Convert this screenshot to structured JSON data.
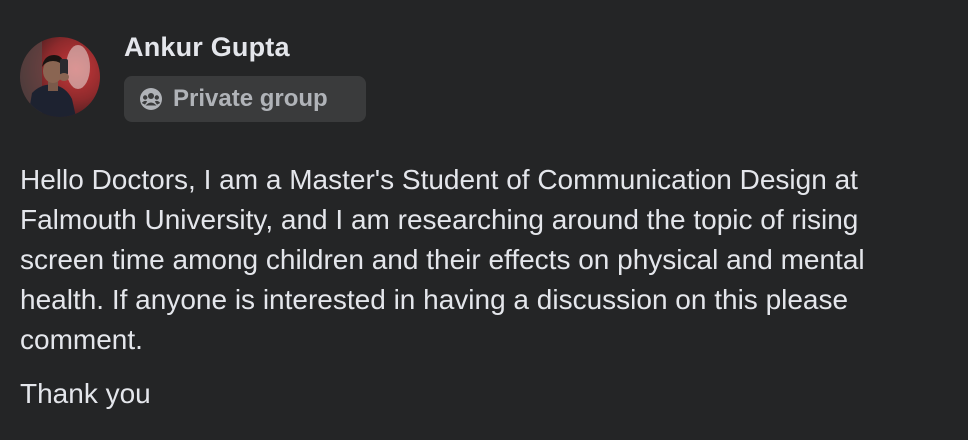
{
  "post": {
    "author": {
      "name": "Ankur Gupta",
      "avatar_icon": "profile-photo"
    },
    "audience": {
      "label": "Private group",
      "icon": "group-icon"
    },
    "body": "Hello Doctors, I am a Master's Student of Communication Design at Falmouth University, and I am researching around the topic of rising screen time among children and their effects on physical and mental health. If anyone is interested in having a discussion on this please comment.",
    "closing": "Thank you"
  },
  "colors": {
    "background": "#242526",
    "text_primary": "#e4e6eb",
    "text_secondary": "#b0b3b8",
    "badge_background": "#3a3b3c"
  }
}
